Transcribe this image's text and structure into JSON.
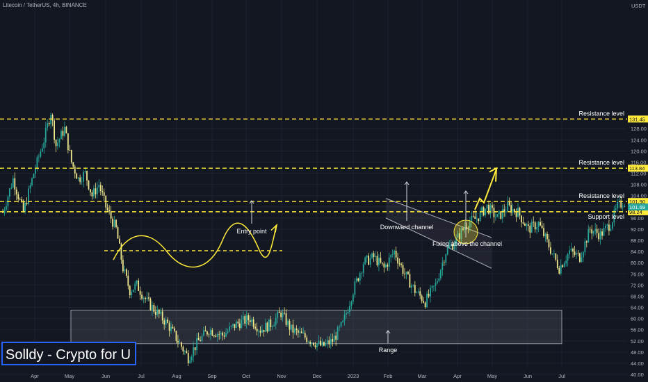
{
  "header": {
    "title": "Litecoin / TetherUS, 4h, BINANCE"
  },
  "watermark": {
    "text": "Solldy - Crypto for U"
  },
  "colors": {
    "background": "#131722",
    "up": "#26a69a",
    "down": "#f0e68c",
    "level_line": "#ffeb3b",
    "annotation": "#ffffff"
  },
  "chart_data": {
    "type": "candlestick",
    "title": "Litecoin / TetherUS, 4h, BINANCE",
    "y_unit": "USDT",
    "ylim": [
      40,
      136
    ],
    "y_ticks": [
      40,
      44,
      48,
      52,
      56,
      60,
      64,
      68,
      72,
      76,
      80,
      84,
      88,
      92,
      96,
      100,
      104,
      108,
      112,
      116,
      120,
      124,
      128
    ],
    "x_ticks": [
      "Apr",
      "May",
      "Jun",
      "Jul",
      "Aug",
      "Sep",
      "Oct",
      "Nov",
      "Dec",
      "2023",
      "Feb",
      "Mar",
      "Apr",
      "May",
      "Jun",
      "Jul"
    ],
    "price_path": [
      [
        0,
        98
      ],
      [
        6,
        110
      ],
      [
        12,
        98
      ],
      [
        18,
        112
      ],
      [
        24,
        124
      ],
      [
        28,
        134
      ],
      [
        31,
        122
      ],
      [
        36,
        128
      ],
      [
        40,
        116
      ],
      [
        44,
        110
      ],
      [
        48,
        112
      ],
      [
        52,
        104
      ],
      [
        56,
        108
      ],
      [
        60,
        100
      ],
      [
        66,
        92
      ],
      [
        70,
        78
      ],
      [
        74,
        70
      ],
      [
        78,
        72
      ],
      [
        84,
        66
      ],
      [
        90,
        62
      ],
      [
        96,
        58
      ],
      [
        102,
        52
      ],
      [
        108,
        46
      ],
      [
        114,
        52
      ],
      [
        120,
        56
      ],
      [
        128,
        54
      ],
      [
        136,
        58
      ],
      [
        144,
        60
      ],
      [
        150,
        56
      ],
      [
        156,
        58
      ],
      [
        162,
        62
      ],
      [
        168,
        56
      ],
      [
        174,
        54
      ],
      [
        180,
        52
      ],
      [
        186,
        50
      ],
      [
        192,
        52
      ],
      [
        198,
        58
      ],
      [
        204,
        70
      ],
      [
        210,
        80
      ],
      [
        216,
        82
      ],
      [
        222,
        78
      ],
      [
        228,
        84
      ],
      [
        234,
        76
      ],
      [
        240,
        70
      ],
      [
        246,
        66
      ],
      [
        252,
        72
      ],
      [
        258,
        84
      ],
      [
        264,
        88
      ],
      [
        270,
        94
      ],
      [
        276,
        96
      ],
      [
        282,
        100
      ],
      [
        288,
        96
      ],
      [
        294,
        100
      ],
      [
        300,
        98
      ],
      [
        306,
        92
      ],
      [
        312,
        94
      ],
      [
        318,
        86
      ],
      [
        324,
        78
      ],
      [
        330,
        84
      ],
      [
        336,
        82
      ],
      [
        342,
        92
      ],
      [
        348,
        90
      ],
      [
        354,
        94
      ],
      [
        358,
        100
      ],
      [
        362,
        102
      ]
    ],
    "levels": [
      {
        "label": "Resistance level",
        "value": 131.45,
        "badge": "131.45"
      },
      {
        "label": "Resistance level",
        "value": 113.84,
        "badge": "113.84"
      },
      {
        "label": "Resistance level",
        "value": 101.9,
        "badge": "101.90"
      },
      {
        "label": "Support level",
        "value": 98.24,
        "badge": "98.24"
      }
    ],
    "current_price": {
      "value": 101.69,
      "badge": "101.69"
    },
    "range_box": {
      "low": 51,
      "high": 63,
      "label": "Range"
    },
    "downward_channel": {
      "label": "Downward channel"
    },
    "annotations": [
      "Entry point",
      "Downward channel",
      "Fixing above the channel",
      "Range"
    ]
  }
}
